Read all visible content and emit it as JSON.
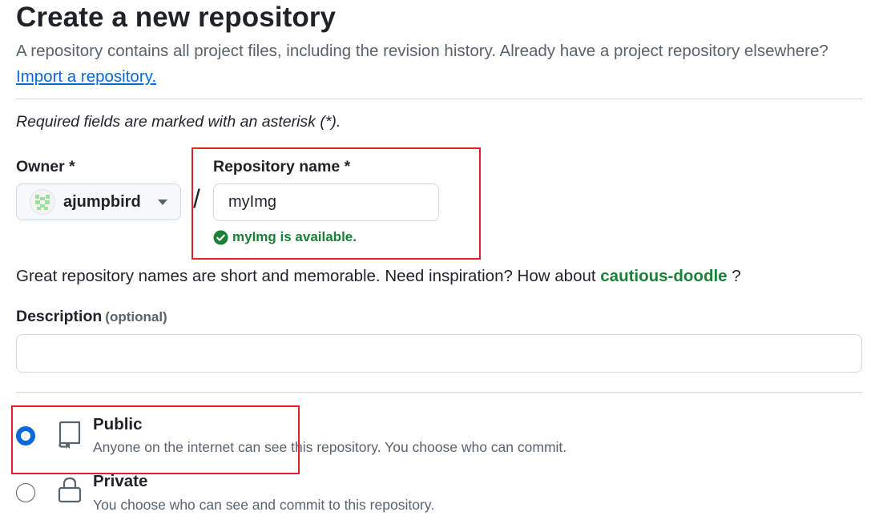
{
  "page": {
    "title": "Create a new repository",
    "subtitle": "A repository contains all project files, including the revision history. Already have a project repository elsewhere?",
    "import_link": "Import a repository.",
    "required_note": "Required fields are marked with an asterisk (*)."
  },
  "owner": {
    "label": "Owner *",
    "value": "ajumpbird",
    "avatar_icon": "identicon-avatar"
  },
  "separator": "/",
  "repository": {
    "label": "Repository name *",
    "value": "myImg",
    "availability": "myImg is available."
  },
  "hint": {
    "text": "Great repository names are short and memorable. Need inspiration? How about ",
    "suggestion": "cautious-doodle",
    "suffix": " ?"
  },
  "description": {
    "label": "Description",
    "optional": "(optional)",
    "value": ""
  },
  "visibility": {
    "options": [
      {
        "label": "Public",
        "desc": "Anyone on the internet can see this repository. You choose who can commit.",
        "icon": "repo-icon",
        "selected": true
      },
      {
        "label": "Private",
        "desc": "You choose who can see and commit to this repository.",
        "icon": "lock-icon",
        "selected": false
      }
    ]
  },
  "colors": {
    "accent": "#0969da",
    "success": "#1a7f37",
    "highlight": "#e5202a"
  }
}
